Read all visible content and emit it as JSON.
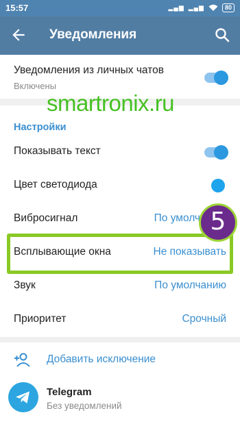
{
  "statusbar": {
    "time": "15:57",
    "battery": "80"
  },
  "appbar": {
    "title": "Уведомления"
  },
  "private_chats": {
    "label": "Уведомления из личных чатов",
    "status": "Включены",
    "enabled": true
  },
  "watermark": "smartronix.ru",
  "settings": {
    "section_title": "Настройки",
    "show_text": {
      "label": "Показывать текст",
      "enabled": true
    },
    "led_color": {
      "label": "Цвет светодиода",
      "color": "#1ea4ec"
    },
    "vibration": {
      "label": "Вибросигнал",
      "value": "По умолч"
    },
    "popup": {
      "label": "Всплывающие окна",
      "value": "Не показывать"
    },
    "sound": {
      "label": "Звук",
      "value": "По умолчанию"
    },
    "priority": {
      "label": "Приоритет",
      "value": "Срочный"
    }
  },
  "step_badge": "5",
  "exceptions": {
    "add_label": "Добавить исключение",
    "items": [
      {
        "name": "Telegram",
        "status": "Без уведомлений"
      }
    ]
  },
  "colors": {
    "appbar": "#527da3",
    "accent": "#3a8fd0",
    "highlight": "#8ac924",
    "watermark": "#46c023"
  }
}
